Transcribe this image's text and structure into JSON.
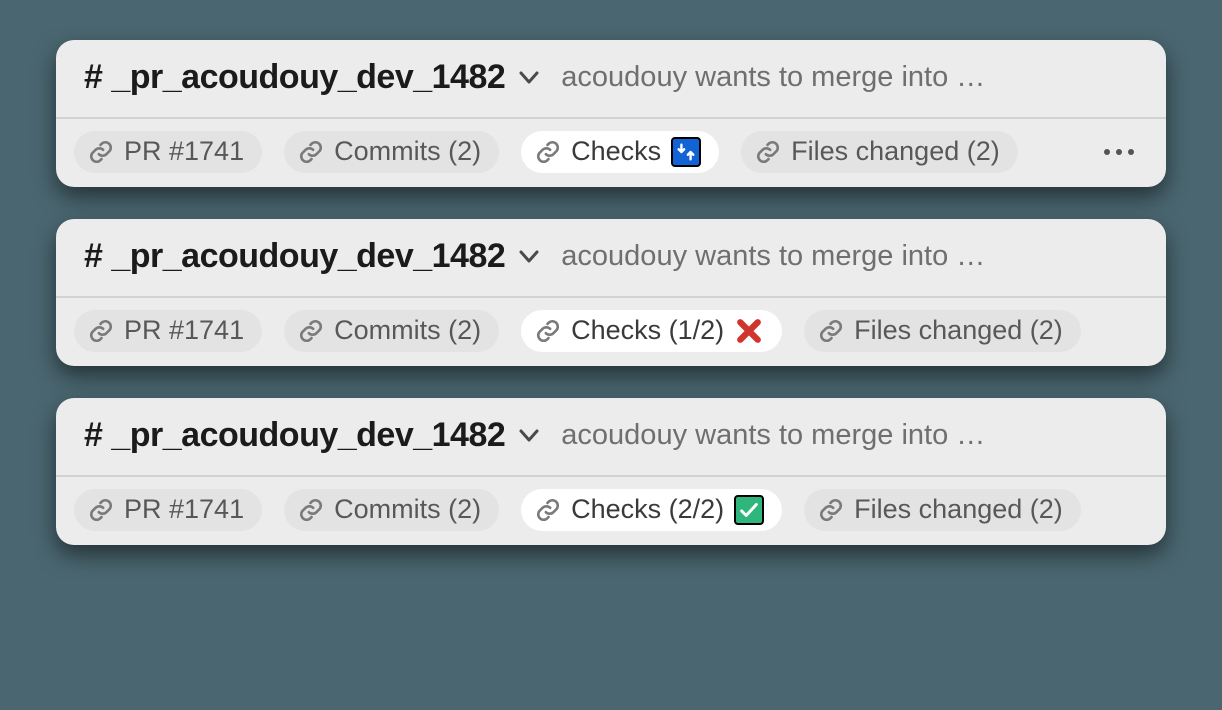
{
  "cards": [
    {
      "channel": "# _pr_acoudouy_dev_1482",
      "subtitle": "acoudouy wants to merge into …",
      "pr_label": "PR #1741",
      "commits_label": "Commits (2)",
      "checks_label": "Checks",
      "checks_status": "loop",
      "files_label": "Files changed (2)",
      "show_more": true
    },
    {
      "channel": "# _pr_acoudouy_dev_1482",
      "subtitle": "acoudouy wants to merge into …",
      "pr_label": "PR #1741",
      "commits_label": "Commits (2)",
      "checks_label": "Checks (1/2)",
      "checks_status": "fail",
      "files_label": "Files changed (2)",
      "show_more": false
    },
    {
      "channel": "# _pr_acoudouy_dev_1482",
      "subtitle": "acoudouy wants to merge into …",
      "pr_label": "PR #1741",
      "commits_label": "Commits (2)",
      "checks_label": "Checks (2/2)",
      "checks_status": "pass",
      "files_label": "Files changed (2)",
      "show_more": false
    }
  ]
}
